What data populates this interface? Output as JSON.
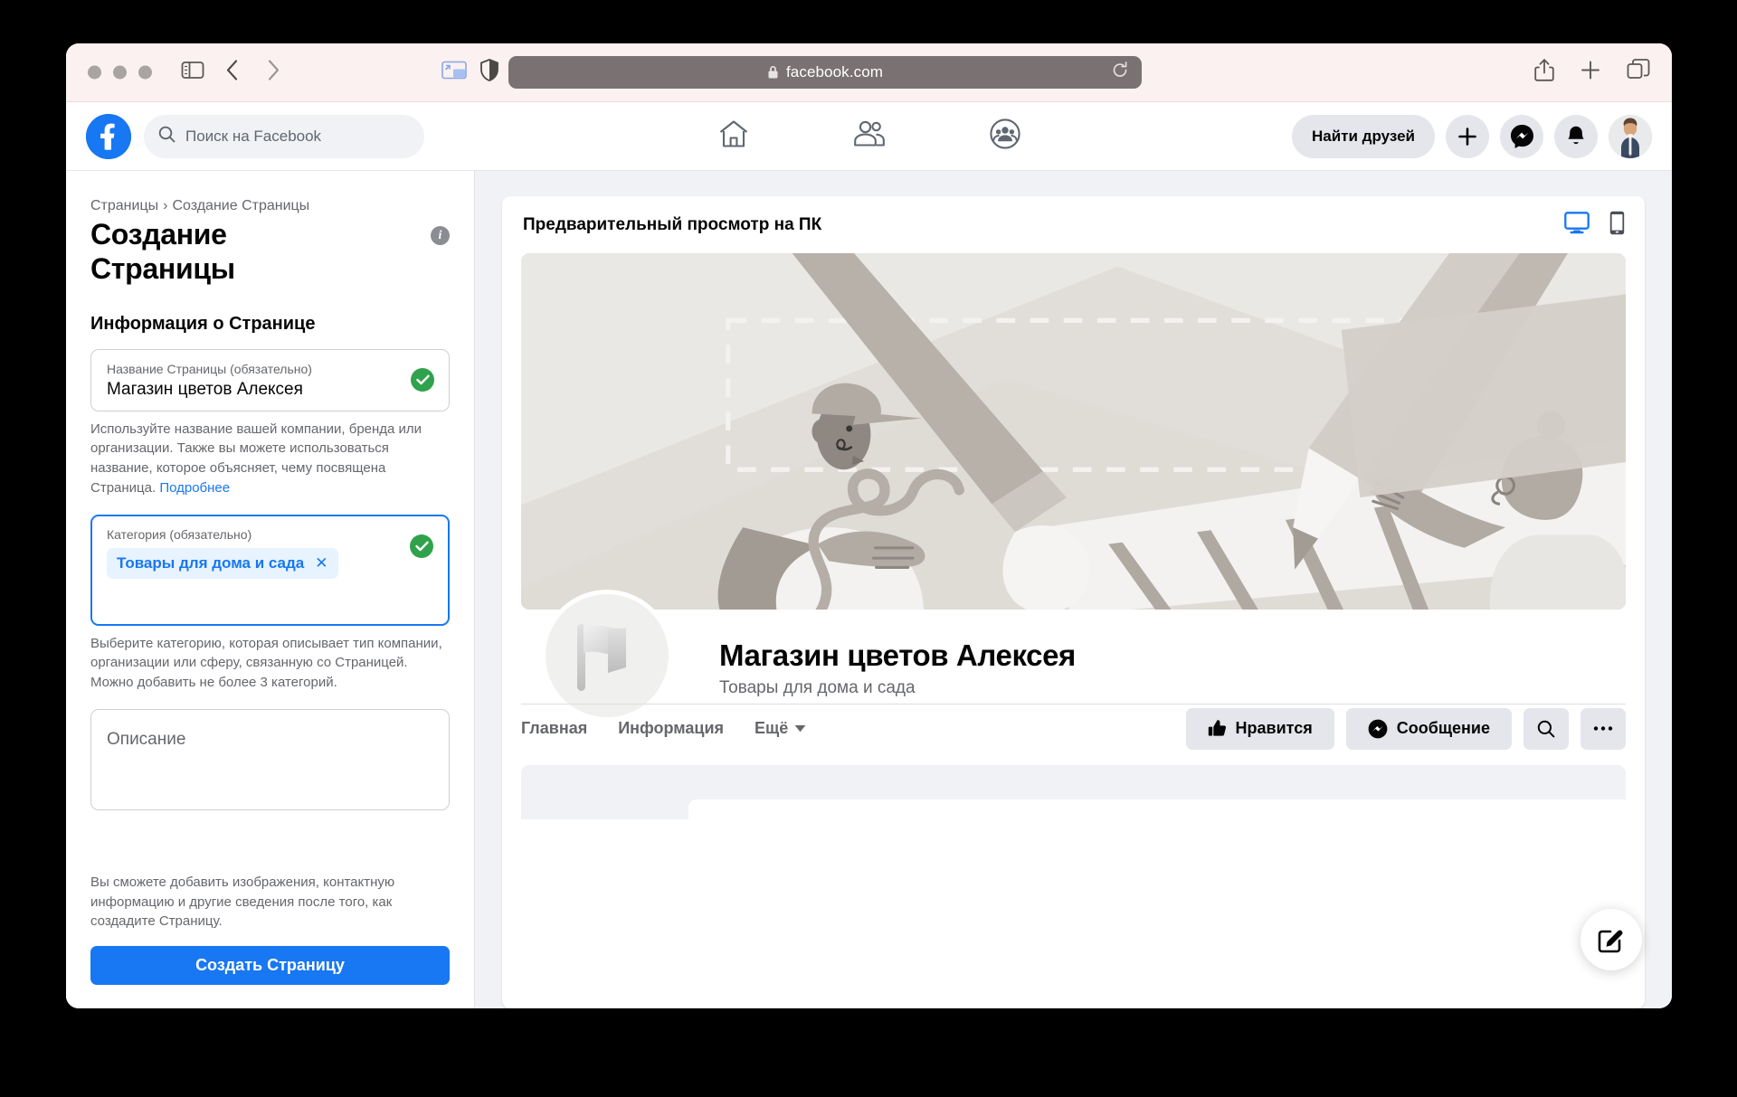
{
  "browser": {
    "url": "facebook.com",
    "icons": {
      "sidebar": "sidebar-toggle-icon",
      "back": "back-arrow-icon",
      "forward": "forward-arrow-icon",
      "pip": "picture-in-picture-icon",
      "shield": "privacy-shield-icon",
      "lock": "lock-icon",
      "reload": "reload-icon",
      "share": "share-icon",
      "newtab": "plus-icon",
      "tabs": "tab-overview-icon"
    }
  },
  "fb_header": {
    "search_placeholder": "Поиск на Facebook",
    "nav": [
      {
        "name": "home-icon"
      },
      {
        "name": "friends-icon"
      },
      {
        "name": "groups-icon"
      }
    ],
    "find_friends_label": "Найти друзей",
    "create_label": "+",
    "messenger_label": "messenger-icon",
    "notifications_label": "bell-icon",
    "account_label": "avatar"
  },
  "form": {
    "breadcrumb": {
      "root": "Страницы",
      "separator": "›",
      "current": "Создание Страницы"
    },
    "title": "Создание\nСтраницы",
    "title_line1": "Создание",
    "title_line2": "Страницы",
    "section_heading": "Информация о Странице",
    "name_field": {
      "label": "Название Страницы (обязательно)",
      "value": "Магазин цветов Алексея",
      "valid": true
    },
    "name_helper": "Используйте название вашей компании, бренда или организации. Также вы можете использоваться название, которое объясняет, чему посвящена Страница. ",
    "name_helper_link": "Подробнее",
    "category_field": {
      "label": "Категория (обязательно)",
      "chips": [
        "Товары для дома и сада"
      ],
      "chip_remove": "✕",
      "valid": true
    },
    "category_helper": "Выберите категорию, которая описывает тип компании, организации или сферу, связанную со Страницей. Можно добавить не более 3 категорий.",
    "description_field": {
      "placeholder": "Описание",
      "value": ""
    },
    "footer_note": "Вы сможете добавить изображения, контактную информацию и другие сведения после того, как создадите Страницу.",
    "submit_label": "Создать Страницу"
  },
  "preview": {
    "heading": "Предварительный просмотр на ПК",
    "device_desktop": "desktop-monitor-icon",
    "device_mobile": "mobile-phone-icon",
    "desktop_active": true,
    "page_name": "Магазин цветов Алексея",
    "page_category": "Товары для дома и сада",
    "profile_placeholder": "flag-icon",
    "nav_items": [
      {
        "label": "Главная",
        "has_caret": false
      },
      {
        "label": "Информация",
        "has_caret": false
      },
      {
        "label": "Ещё",
        "has_caret": true
      }
    ],
    "actions": {
      "like_label": "Нравится",
      "like_icon": "thumbs-up-icon",
      "message_label": "Сообщение",
      "message_icon": "messenger-icon",
      "search_icon": "search-icon",
      "more_icon": "ellipsis-icon"
    },
    "fab_icon": "compose-edit-icon"
  },
  "colors": {
    "fb_blue": "#1877f2",
    "valid_green": "#31a24c",
    "chip_bg": "#e7f3ff",
    "grey_btn": "#e4e6eb",
    "page_bg": "#f0f2f5",
    "toolbar_bg": "#faf1f0",
    "urlbar_bg": "#7a7272",
    "cover_bg": "#eae8e4"
  }
}
